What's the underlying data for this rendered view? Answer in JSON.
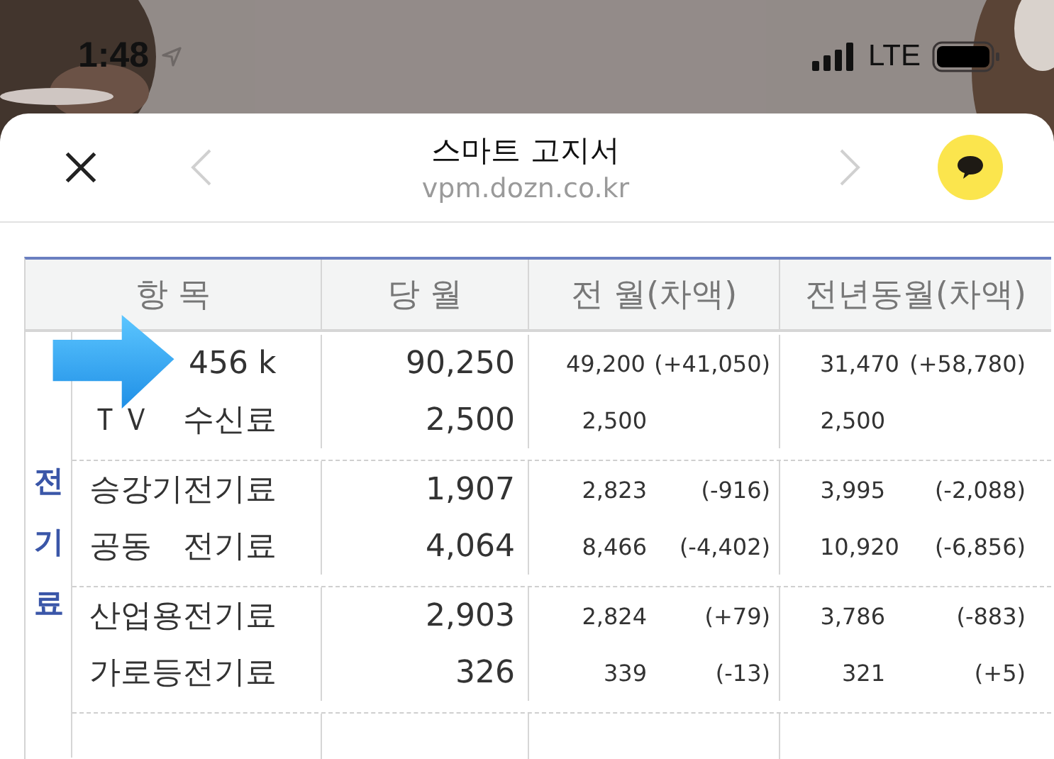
{
  "status_bar": {
    "time": "1:48",
    "network": "LTE"
  },
  "browser": {
    "title": "스마트 고지서",
    "url": "vpm.dozn.co.kr",
    "back_disabled": true,
    "forward_disabled": true
  },
  "table": {
    "columns": [
      "항 목",
      "당 월",
      "전 월(차액)",
      "전년동월(차액)"
    ],
    "group_label": "전기료",
    "groups": [
      {
        "rows": [
          {
            "item": "456 k",
            "current": "90,250",
            "prev": "49,200",
            "prev_diff": "(+41,050)",
            "yoy": "31,470",
            "yoy_diff": "(+58,780)"
          },
          {
            "item": "ＴＶ　수신료",
            "current": "2,500",
            "prev": "2,500",
            "yoy": "2,500"
          }
        ]
      },
      {
        "rows": [
          {
            "item": "승강기전기료",
            "current": "1,907",
            "prev": "2,823",
            "prev_diff": "(-916)",
            "yoy": "3,995",
            "yoy_diff": "(-2,088)"
          },
          {
            "item": "공동　전기료",
            "current": "4,064",
            "prev": "8,466",
            "prev_diff": "(-4,402)",
            "yoy": "10,920",
            "yoy_diff": "(-6,856)"
          }
        ]
      },
      {
        "rows": [
          {
            "item": "산업용전기료",
            "current": "2,903",
            "prev": "2,824",
            "prev_diff": "(+79)",
            "yoy": "3,786",
            "yoy_diff": "(-883)"
          },
          {
            "item": "가로등전기료",
            "current": "326",
            "prev": "339",
            "prev_diff": "(-13)",
            "yoy": "321",
            "yoy_diff": "(+5)"
          }
        ]
      }
    ]
  }
}
